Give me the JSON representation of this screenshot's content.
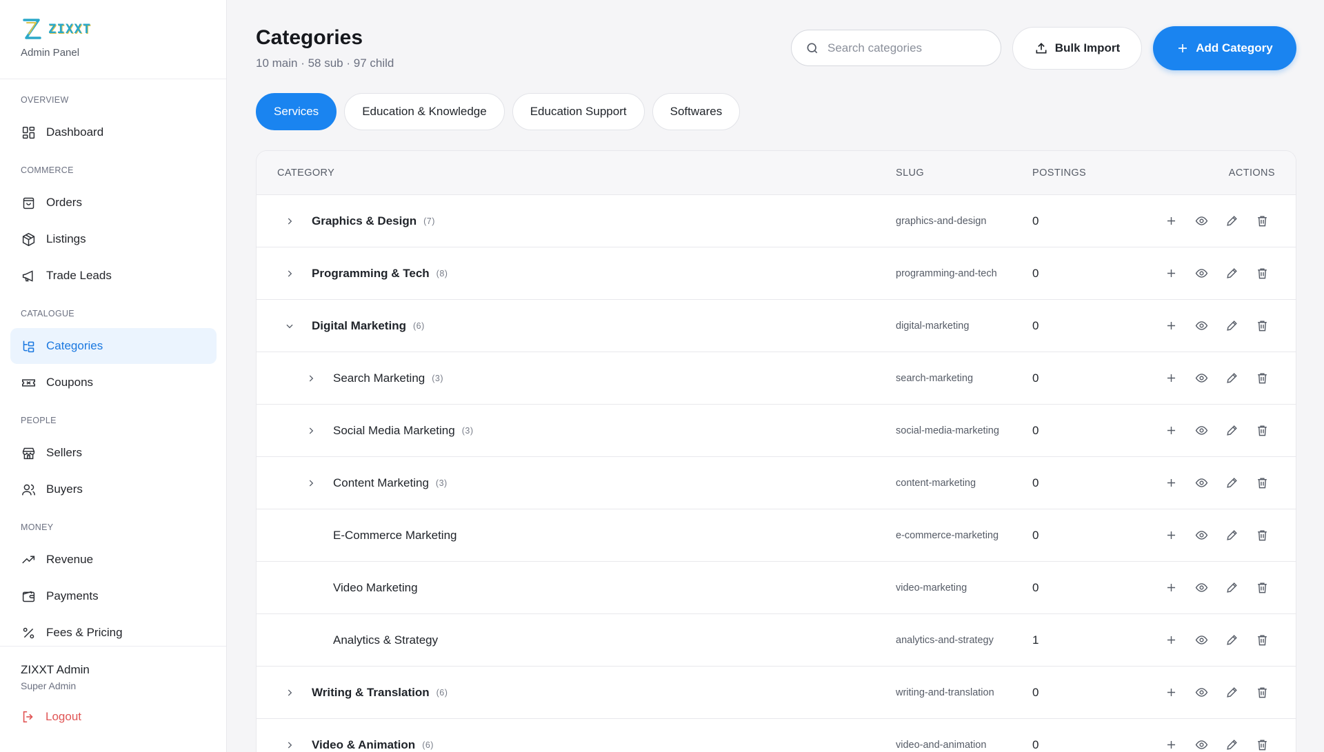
{
  "brand": {
    "logo_text": "ZIXXT",
    "subtitle": "Admin Panel"
  },
  "sidebar": {
    "sections": [
      {
        "label": "OVERVIEW",
        "items": [
          {
            "label": "Dashboard",
            "icon": "dashboard-icon"
          }
        ]
      },
      {
        "label": "COMMERCE",
        "items": [
          {
            "label": "Orders",
            "icon": "bag-icon"
          },
          {
            "label": "Listings",
            "icon": "box-icon"
          },
          {
            "label": "Trade Leads",
            "icon": "megaphone-icon"
          }
        ]
      },
      {
        "label": "CATALOGUE",
        "items": [
          {
            "label": "Categories",
            "icon": "tree-icon",
            "active": true
          },
          {
            "label": "Coupons",
            "icon": "ticket-icon"
          }
        ]
      },
      {
        "label": "PEOPLE",
        "items": [
          {
            "label": "Sellers",
            "icon": "store-icon"
          },
          {
            "label": "Buyers",
            "icon": "users-icon"
          }
        ]
      },
      {
        "label": "MONEY",
        "items": [
          {
            "label": "Revenue",
            "icon": "trend-icon"
          },
          {
            "label": "Payments",
            "icon": "wallet-icon"
          },
          {
            "label": "Fees & Pricing",
            "icon": "percent-icon"
          }
        ]
      }
    ],
    "user": {
      "name": "ZIXXT Admin",
      "role": "Super Admin",
      "logout_label": "Logout"
    }
  },
  "header": {
    "title": "Categories",
    "subtitle": "10 main · 58 sub · 97 child",
    "search_placeholder": "Search categories",
    "bulk_import_label": "Bulk Import",
    "add_category_label": "Add Category"
  },
  "tabs": [
    {
      "label": "Services",
      "active": true
    },
    {
      "label": "Education & Knowledge",
      "active": false
    },
    {
      "label": "Education Support",
      "active": false
    },
    {
      "label": "Softwares",
      "active": false
    }
  ],
  "table": {
    "columns": {
      "category": "CATEGORY",
      "slug": "SLUG",
      "postings": "POSTINGS",
      "actions": "ACTIONS"
    },
    "rows": [
      {
        "name": "Graphics & Design",
        "count": "(7)",
        "slug": "graphics-and-design",
        "postings": "0",
        "level": 1,
        "expander": "collapsed"
      },
      {
        "name": "Programming & Tech",
        "count": "(8)",
        "slug": "programming-and-tech",
        "postings": "0",
        "level": 1,
        "expander": "collapsed"
      },
      {
        "name": "Digital Marketing",
        "count": "(6)",
        "slug": "digital-marketing",
        "postings": "0",
        "level": 1,
        "expander": "expanded"
      },
      {
        "name": "Search Marketing",
        "count": "(3)",
        "slug": "search-marketing",
        "postings": "0",
        "level": 2,
        "expander": "collapsed"
      },
      {
        "name": "Social Media Marketing",
        "count": "(3)",
        "slug": "social-media-marketing",
        "postings": "0",
        "level": 2,
        "expander": "collapsed"
      },
      {
        "name": "Content Marketing",
        "count": "(3)",
        "slug": "content-marketing",
        "postings": "0",
        "level": 2,
        "expander": "collapsed"
      },
      {
        "name": "E-Commerce Marketing",
        "count": "",
        "slug": "e-commerce-marketing",
        "postings": "0",
        "level": 2,
        "expander": "none"
      },
      {
        "name": "Video Marketing",
        "count": "",
        "slug": "video-marketing",
        "postings": "0",
        "level": 2,
        "expander": "none"
      },
      {
        "name": "Analytics & Strategy",
        "count": "",
        "slug": "analytics-and-strategy",
        "postings": "1",
        "level": 2,
        "expander": "none"
      },
      {
        "name": "Writing & Translation",
        "count": "(6)",
        "slug": "writing-and-translation",
        "postings": "0",
        "level": 1,
        "expander": "collapsed"
      },
      {
        "name": "Video & Animation",
        "count": "(6)",
        "slug": "video-and-animation",
        "postings": "0",
        "level": 1,
        "expander": "collapsed"
      }
    ]
  },
  "colors": {
    "accent": "#1a84f0",
    "active_bg": "#ebf4fe",
    "logout": "#e05555"
  }
}
